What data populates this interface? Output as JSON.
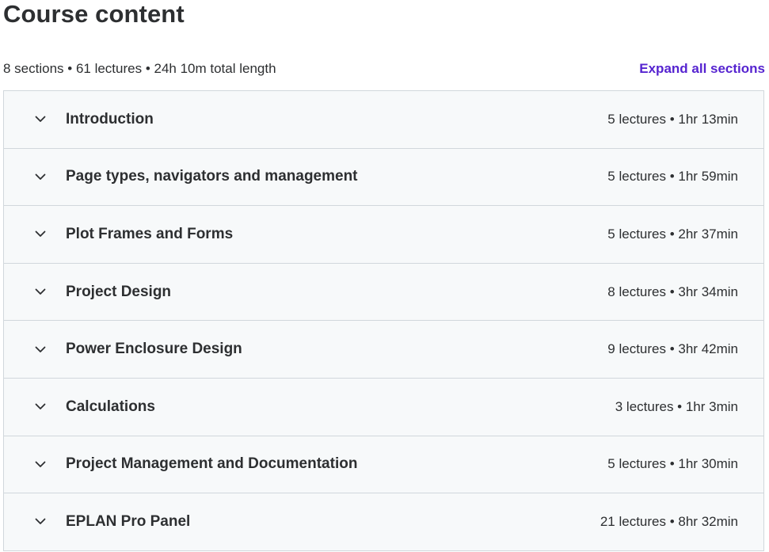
{
  "header": {
    "title": "Course content"
  },
  "summary": {
    "text": "8 sections • 61 lectures • 24h 10m total length",
    "expand_label": "Expand all sections"
  },
  "colors": {
    "accent": "#5624d0",
    "text": "#2d2f31",
    "section_bg": "#f7f9fa",
    "border": "#d1d7dc"
  },
  "sections": [
    {
      "title": "Introduction",
      "meta": "5 lectures • 1hr 13min",
      "icon": "chevron-down-icon"
    },
    {
      "title": "Page types, navigators and management",
      "meta": "5 lectures • 1hr 59min",
      "icon": "chevron-down-icon"
    },
    {
      "title": "Plot Frames and Forms",
      "meta": "5 lectures • 2hr 37min",
      "icon": "chevron-down-icon"
    },
    {
      "title": "Project Design",
      "meta": "8 lectures • 3hr 34min",
      "icon": "chevron-down-icon"
    },
    {
      "title": "Power Enclosure Design",
      "meta": "9 lectures • 3hr 42min",
      "icon": "chevron-down-icon"
    },
    {
      "title": "Calculations",
      "meta": "3 lectures • 1hr 3min",
      "icon": "chevron-down-icon"
    },
    {
      "title": "Project Management and Documentation",
      "meta": "5 lectures • 1hr 30min",
      "icon": "chevron-down-icon"
    },
    {
      "title": "EPLAN Pro Panel",
      "meta": "21 lectures • 8hr 32min",
      "icon": "chevron-down-icon"
    }
  ]
}
